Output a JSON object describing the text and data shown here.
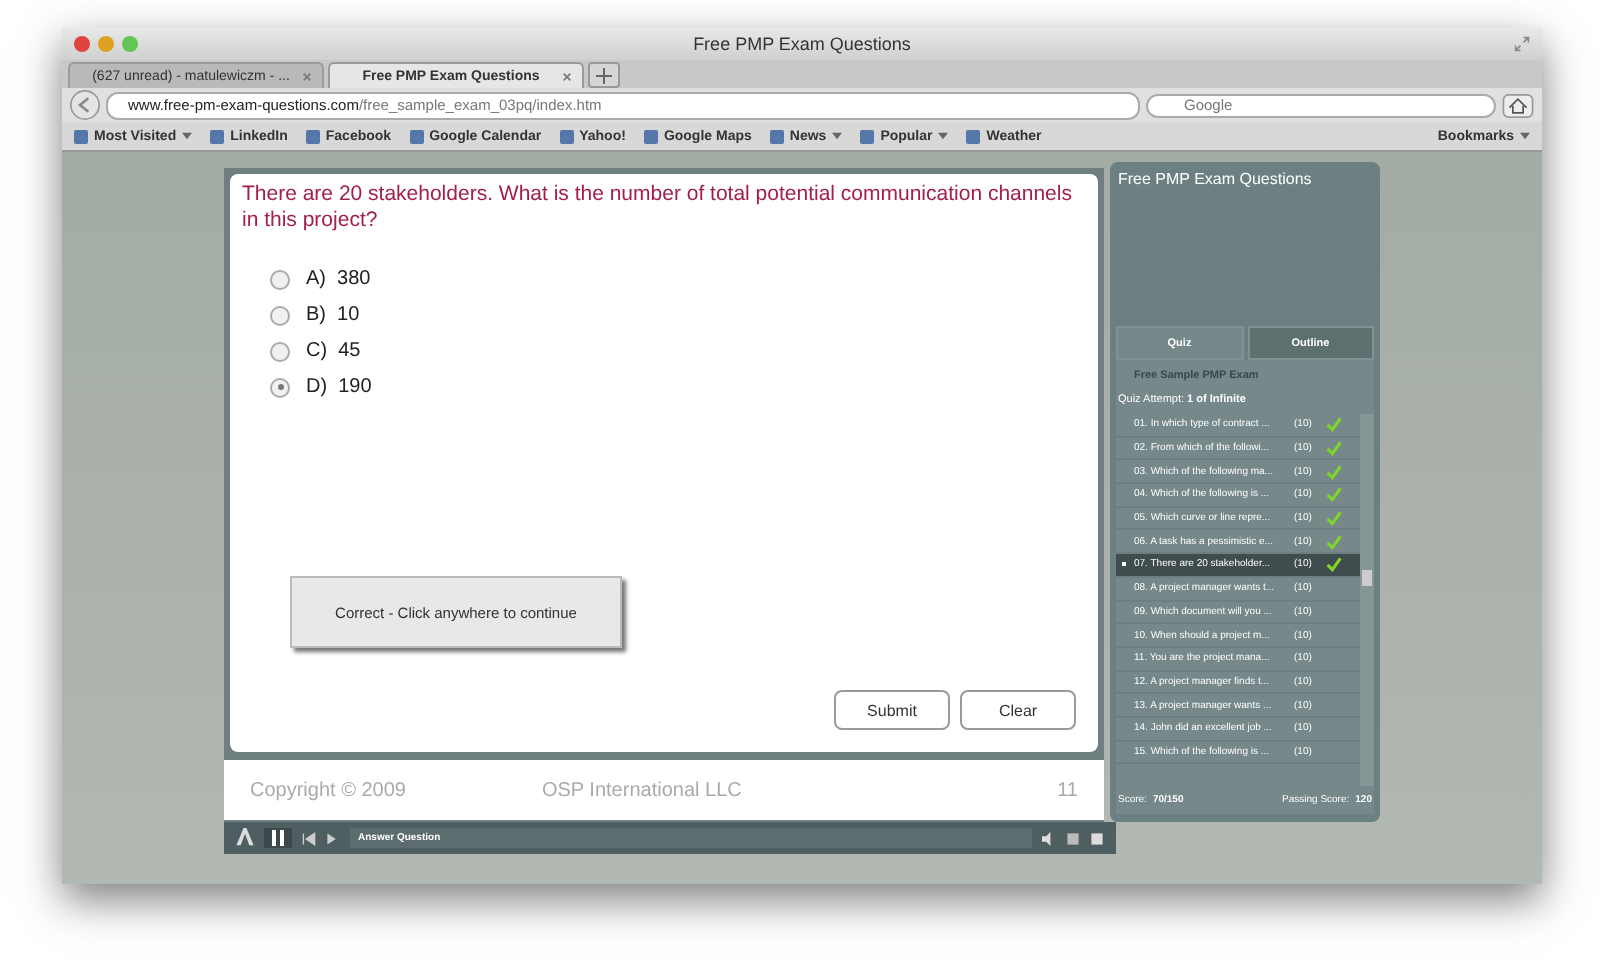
{
  "window": {
    "title": "Free PMP Exam Questions"
  },
  "tabs": [
    {
      "label": "(627 unread) - matulewiczm - ...",
      "selected": false
    },
    {
      "label": "Free PMP Exam Questions",
      "selected": true
    }
  ],
  "address_bar": {
    "domain": "www.free-pm-exam-questions.com",
    "path": "/free_sample_exam_03pq/index.htm"
  },
  "search": {
    "placeholder": "Google"
  },
  "bookmarks": [
    {
      "label": "Most Visited",
      "menu": true
    },
    {
      "label": "LinkedIn",
      "menu": false
    },
    {
      "label": "Facebook",
      "menu": false
    },
    {
      "label": "Google Calendar",
      "menu": false
    },
    {
      "label": "Yahoo!",
      "menu": false
    },
    {
      "label": "Google Maps",
      "menu": false
    },
    {
      "label": "News",
      "menu": true
    },
    {
      "label": "Popular",
      "menu": true
    },
    {
      "label": "Weather",
      "menu": false
    }
  ],
  "bookmarks_menu": "Bookmarks",
  "quiz": {
    "question": "There are 20 stakeholders. What is the number of total potential communication channels in this project?",
    "options": [
      {
        "letter": "A)",
        "text": "380",
        "selected": false
      },
      {
        "letter": "B)",
        "text": "10",
        "selected": false
      },
      {
        "letter": "C)",
        "text": "45",
        "selected": false
      },
      {
        "letter": "D)",
        "text": "190",
        "selected": true
      }
    ],
    "feedback": "Correct - Click anywhere to continue",
    "buttons": [
      "Submit",
      "Clear"
    ]
  },
  "footer": {
    "copyright": "Copyright © 2009",
    "company": "OSP International LLC",
    "page": "11"
  },
  "player": {
    "status": "Answer Question"
  },
  "sidebar": {
    "title": "Free PMP Exam Questions",
    "tabs": [
      {
        "label": "Quiz",
        "selected": true
      },
      {
        "label": "Outline",
        "selected": false
      }
    ],
    "exam_title": "Free Sample PMP Exam",
    "attempt_label": "Quiz Attempt:",
    "attempt_value": "1 of Infinite",
    "items": [
      {
        "label": "01. In which type of contract ...",
        "points": "(10)",
        "checked": true,
        "selected": false
      },
      {
        "label": "02. From which of the followi...",
        "points": "(10)",
        "checked": true,
        "selected": false
      },
      {
        "label": "03. Which of the following ma...",
        "points": "(10)",
        "checked": true,
        "selected": false
      },
      {
        "label": "04. Which of the following is ...",
        "points": "(10)",
        "checked": true,
        "selected": false
      },
      {
        "label": "05. Which curve or line repre...",
        "points": "(10)",
        "checked": true,
        "selected": false
      },
      {
        "label": "06. A task has a pessimistic e...",
        "points": "(10)",
        "checked": true,
        "selected": false
      },
      {
        "label": "07. There are 20 stakeholder...",
        "points": "(10)",
        "checked": true,
        "selected": true
      },
      {
        "label": "08. A project manager wants t...",
        "points": "(10)",
        "checked": false,
        "selected": false
      },
      {
        "label": "09. Which document will you ...",
        "points": "(10)",
        "checked": false,
        "selected": false
      },
      {
        "label": "10. When should a project m...",
        "points": "(10)",
        "checked": false,
        "selected": false
      },
      {
        "label": "11. You are the project mana...",
        "points": "(10)",
        "checked": false,
        "selected": false
      },
      {
        "label": "12. A project manager finds t...",
        "points": "(10)",
        "checked": false,
        "selected": false
      },
      {
        "label": "13. A project manager wants ...",
        "points": "(10)",
        "checked": false,
        "selected": false
      },
      {
        "label": "14. John did an excellent job ...",
        "points": "(10)",
        "checked": false,
        "selected": false
      },
      {
        "label": "15. Which of the following is ...",
        "points": "(10)",
        "checked": false,
        "selected": false
      }
    ],
    "score_label": "Score:",
    "score_value": "70/150",
    "passing_label": "Passing Score:",
    "passing_value": "120"
  }
}
